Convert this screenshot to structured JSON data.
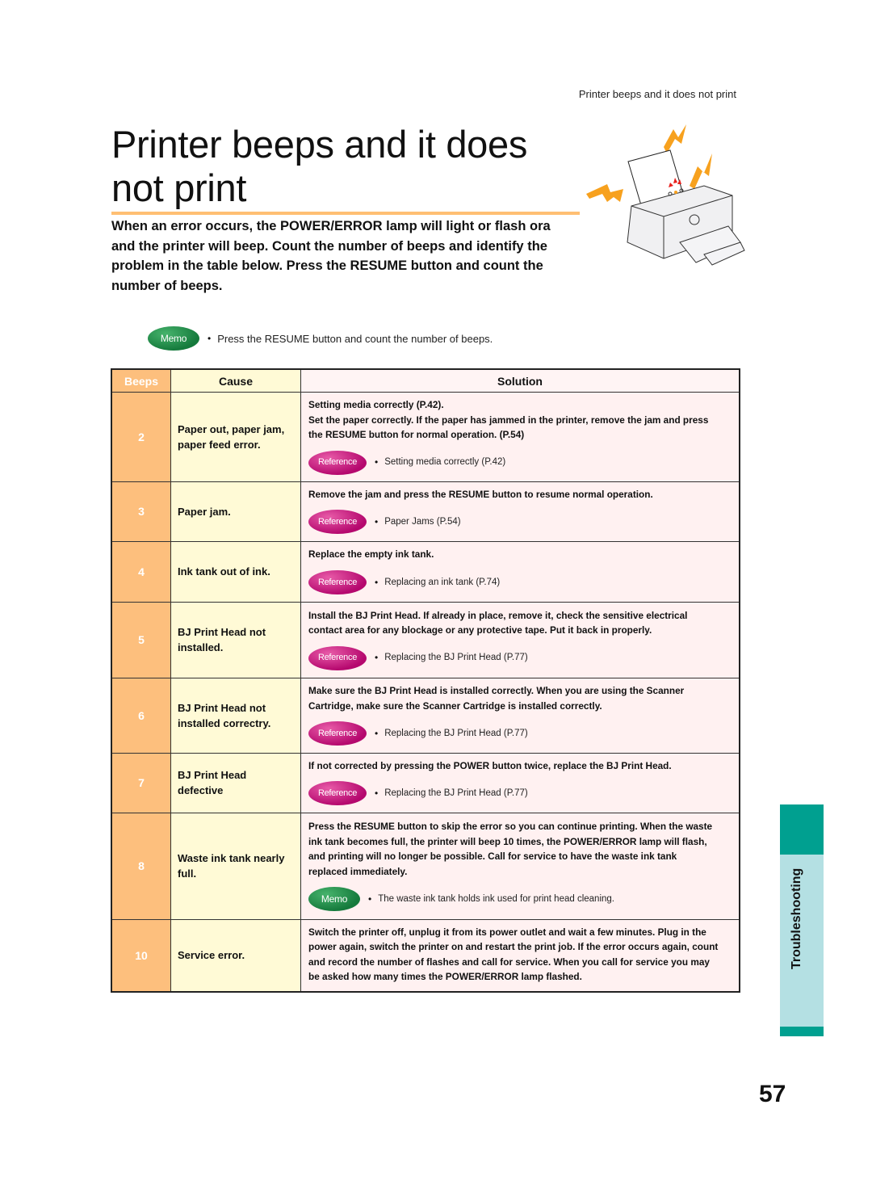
{
  "running_head": "Printer beeps and it does not print",
  "title_lines": [
    "Printer beeps and it does",
    "not print"
  ],
  "intro_lines": [
    "When an error occurs, the POWER/ERROR lamp will light or flash ora",
    "and the printer will beep.  Count the number of beeps and identify the",
    "problem in the table below. Press the RESUME button and count the",
    "number of beeps."
  ],
  "memo": {
    "badge": "Memo",
    "bullet": "•",
    "text": "Press the RESUME button and count the number of beeps."
  },
  "table": {
    "headers": {
      "beeps": "Beeps",
      "cause": "Cause",
      "solution": "Solution"
    },
    "rows": [
      {
        "beeps": "2",
        "cause": [
          "Paper out, paper jam,",
          "paper feed error."
        ],
        "solution": [
          "Setting media correctly (P.42).",
          "Set the paper correctly. If the paper has jammed in the printer, remove the jam and press",
          "the RESUME button for normal operation. (P.54)"
        ],
        "note_type": "Reference",
        "note": "Setting media correctly (P.42)"
      },
      {
        "beeps": "3",
        "cause": [
          "Paper jam."
        ],
        "solution": [
          "Remove the jam and press the RESUME button to resume normal operation."
        ],
        "note_type": "Reference",
        "note": "Paper Jams (P.54)"
      },
      {
        "beeps": "4",
        "cause": [
          "Ink tank out of ink."
        ],
        "solution": [
          "Replace the empty ink tank."
        ],
        "note_type": "Reference",
        "note": "Replacing an ink tank (P.74)"
      },
      {
        "beeps": "5",
        "cause": [
          "BJ Print Head not",
          "installed."
        ],
        "solution": [
          "Install the BJ Print Head.  If already in place, remove it, check the sensitive electrical",
          "contact area for any blockage or any protective tape.  Put it back in properly."
        ],
        "note_type": "Reference",
        "note": "Replacing the BJ Print Head (P.77)"
      },
      {
        "beeps": "6",
        "cause": [
          "BJ Print Head not",
          "installed correctry."
        ],
        "solution": [
          "Make sure the BJ Print Head is installed correctly.  When you are using the Scanner",
          "Cartridge, make sure the Scanner Cartridge is installed correctly."
        ],
        "note_type": "Reference",
        "note": "Replacing the BJ Print Head (P.77)"
      },
      {
        "beeps": "7",
        "cause": [
          "BJ Print Head",
          "defective"
        ],
        "solution": [
          "If not corrected by pressing the POWER button twice, replace the BJ Print Head."
        ],
        "note_type": "Reference",
        "note": "Replacing the BJ Print Head (P.77)"
      },
      {
        "beeps": "8",
        "cause": [
          "Waste ink tank nearly",
          "full."
        ],
        "solution": [
          "Press the RESUME button to skip the error so you can continue printing.  When the waste",
          "ink tank becomes full, the printer will beep 10 times, the POWER/ERROR lamp will flash,",
          "and printing will no longer be possible.  Call for service to have the waste ink tank",
          "replaced immediately."
        ],
        "note_type": "Memo",
        "note": "The waste ink tank holds ink used for print head cleaning."
      },
      {
        "beeps": "10",
        "cause": [
          "Service error."
        ],
        "solution": [
          "Switch the printer off, unplug it from its power outlet and wait a few minutes.  Plug in the",
          "power again, switch the printer on and restart the print job.  If the error occurs again, count",
          "and record the number of flashes and call for service. When you call for service you may",
          "be asked how many times the POWER/ERROR lamp flashed."
        ],
        "note_type": null,
        "note": null
      }
    ]
  },
  "side_tab": "Troubleshooting",
  "page_number": "57",
  "colors": {
    "beeps_column": "#fdbf7d",
    "cause_column": "#fffad6",
    "solution_column": "#fff1f1",
    "reference_badge": "#c8157e",
    "memo_badge": "#1f8a45",
    "title_rule": "#ffbf73",
    "side_tab_dark": "#00a090",
    "side_tab_light": "#b4e0e3",
    "lightning": "#f7a11e"
  }
}
